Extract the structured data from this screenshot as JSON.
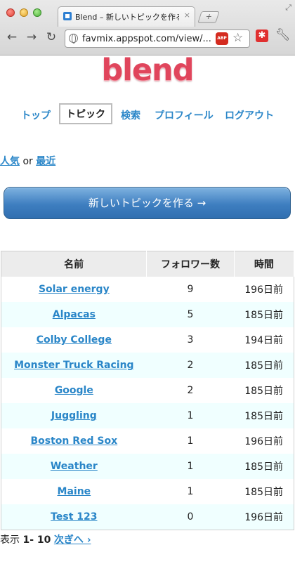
{
  "browser": {
    "tab_title": "Blend – 新しいトピックを作る",
    "tab_close": "×",
    "url": "favmix.appspot.com/view/...",
    "abp_label": "ABP"
  },
  "logo": "blend",
  "menu": {
    "items": [
      {
        "label": "トップ"
      },
      {
        "label": "トピック",
        "active": true
      },
      {
        "label": "検索"
      },
      {
        "label": "プロフィール"
      },
      {
        "label": "ログアウト"
      }
    ]
  },
  "sort": {
    "popular": "人気",
    "or": "or",
    "recent": "最近"
  },
  "create_button": "新しいトピックを作る →",
  "table": {
    "headers": {
      "name": "名前",
      "followers": "フォロワー数",
      "time": "時間"
    },
    "rows": [
      {
        "name": "Solar energy",
        "followers": "9",
        "time": "196日前"
      },
      {
        "name": "Alpacas",
        "followers": "5",
        "time": "185日前"
      },
      {
        "name": "Colby College",
        "followers": "3",
        "time": "194日前"
      },
      {
        "name": "Monster Truck Racing",
        "followers": "2",
        "time": "185日前"
      },
      {
        "name": "Google",
        "followers": "2",
        "time": "185日前"
      },
      {
        "name": "Juggling",
        "followers": "1",
        "time": "185日前"
      },
      {
        "name": "Boston Red Sox",
        "followers": "1",
        "time": "196日前"
      },
      {
        "name": "Weather",
        "followers": "1",
        "time": "185日前"
      },
      {
        "name": "Maine",
        "followers": "1",
        "time": "185日前"
      },
      {
        "name": "Test 123",
        "followers": "0",
        "time": "196日前"
      }
    ]
  },
  "pager": {
    "label": "表示",
    "range": "1- 10",
    "next": "次ぎへ ›"
  },
  "colors": {
    "link": "#2a86c8",
    "logo": "#e0455c",
    "button": "#3e7ec0",
    "row_alt": "#f0ffff"
  }
}
